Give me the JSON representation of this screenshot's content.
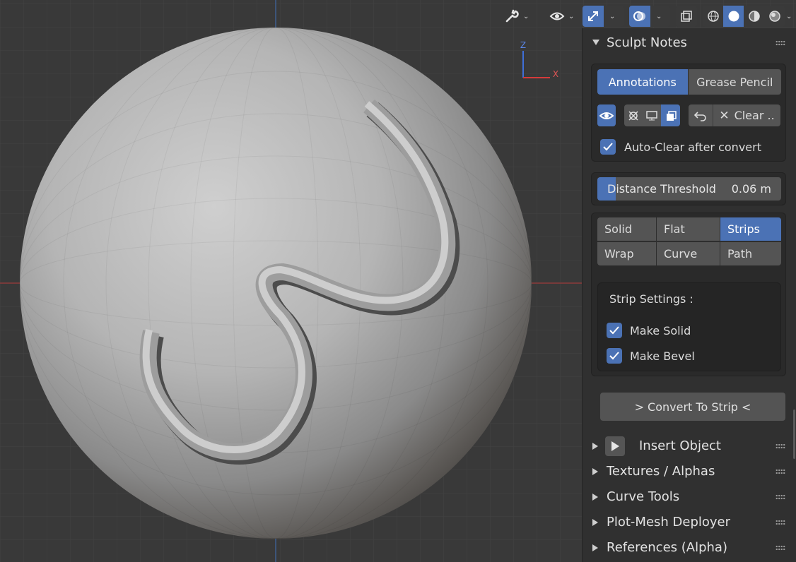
{
  "viewport": {
    "axis_gizmo": {
      "z_label": "Z",
      "x_label": "X"
    }
  },
  "panel": {
    "title": "Sculpt Notes",
    "mode_tabs": [
      {
        "label": "Annotations",
        "active": true
      },
      {
        "label": "Grease Pencil",
        "active": false
      }
    ],
    "clear_label": "Clear ..",
    "auto_clear": {
      "label": "Auto-Clear after convert",
      "checked": true
    },
    "distance_threshold": {
      "label": "Distance Threshold",
      "value": "0.06 m",
      "fill_fraction": 0.1
    },
    "types": [
      {
        "label": "Solid",
        "active": false
      },
      {
        "label": "Flat",
        "active": false
      },
      {
        "label": "Strips",
        "active": true
      },
      {
        "label": "Wrap",
        "active": false
      },
      {
        "label": "Curve",
        "active": false
      },
      {
        "label": "Path",
        "active": false
      }
    ],
    "strip_settings": {
      "title": "Strip Settings :",
      "make_solid": {
        "label": "Make Solid",
        "checked": true
      },
      "make_bevel": {
        "label": "Make Bevel",
        "checked": true
      }
    },
    "convert_label": "> Convert To Strip <",
    "subpanels": [
      {
        "label": "Insert Object"
      },
      {
        "label": "Textures / Alphas"
      },
      {
        "label": "Curve Tools"
      },
      {
        "label": "Plot-Mesh Deployer"
      },
      {
        "label": "References (Alpha)"
      }
    ]
  },
  "colors": {
    "accent": "#4b72b5",
    "panel_bg": "#303030",
    "viewport_bg": "#393939"
  }
}
